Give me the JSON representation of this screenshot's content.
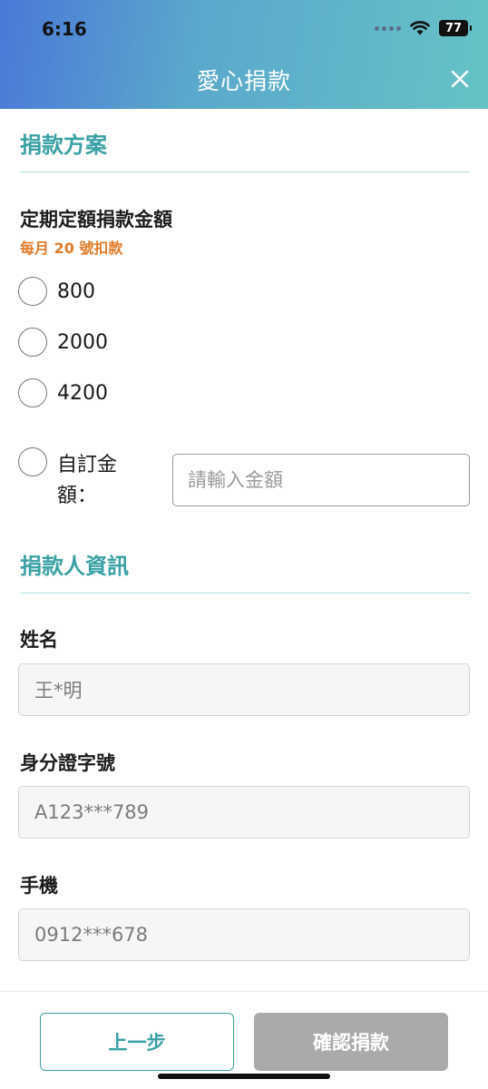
{
  "status_bar": {
    "time": "6:16",
    "battery": "77"
  },
  "header": {
    "title": "愛心捐款",
    "close_icon": "close-icon"
  },
  "plan_section": {
    "title": "捐款方案",
    "amount_label": "定期定額捐款金額",
    "deduct_note": "每月 20 號扣款",
    "options": [
      {
        "label": "800",
        "selected": false
      },
      {
        "label": "2000",
        "selected": false
      },
      {
        "label": "4200",
        "selected": false
      }
    ],
    "custom_label": "自訂金額：",
    "custom_placeholder": "請輸入金額"
  },
  "donor_section": {
    "title": "捐款人資訊",
    "fields": [
      {
        "label": "姓名",
        "value": "王*明"
      },
      {
        "label": "身分證字號",
        "value": "A123***789"
      },
      {
        "label": "手機",
        "value": "0912***678"
      }
    ]
  },
  "footer": {
    "prev_label": "上一步",
    "confirm_label": "確認捐款"
  },
  "colors": {
    "accent": "#3aa1a4",
    "note_orange": "#e07b2a",
    "disabled_button": "#aaaaaa"
  }
}
